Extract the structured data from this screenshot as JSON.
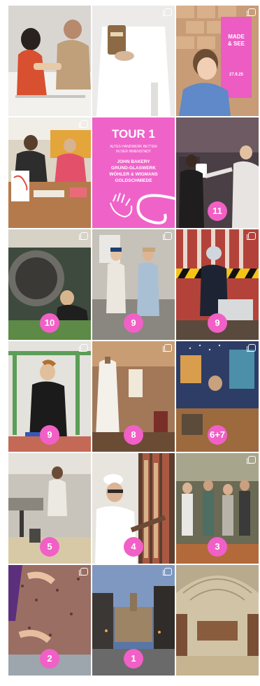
{
  "poster": {
    "title": "TOUR 1",
    "subtitle_line1": "ALTES HANDWERK BETTEN",
    "subtitle_line2": "IN DER INNENSTADT",
    "names": [
      "JOHN BAKERY",
      "GRUND-GLASWERK",
      "WÖHLER & WIGMANS",
      "GOLDSCHMIEDE"
    ]
  },
  "sign": {
    "line1": "MADE",
    "line2": "& SEE",
    "line3": "27.9.25"
  },
  "tiles": [
    {
      "name": "tile-workshop-kneading",
      "badge": ""
    },
    {
      "name": "tile-bread-bag",
      "badge": ""
    },
    {
      "name": "tile-woman-sign",
      "badge": ""
    },
    {
      "name": "tile-workshop-table",
      "badge": ""
    },
    {
      "name": "tile-tour-poster",
      "badge": ""
    },
    {
      "name": "tile-ticket-scan",
      "badge": "11"
    },
    {
      "name": "tile-copper-kettle",
      "badge": "10"
    },
    {
      "name": "tile-kitchen-visitors",
      "badge": "9"
    },
    {
      "name": "tile-boy-helmet",
      "badge": "9"
    },
    {
      "name": "tile-young-man-workbench",
      "badge": "9"
    },
    {
      "name": "tile-dress-form",
      "badge": "8"
    },
    {
      "name": "tile-blue-room",
      "badge": "6+7"
    },
    {
      "name": "tile-workshop-machines",
      "badge": "5"
    },
    {
      "name": "tile-hat-man-books",
      "badge": "4"
    },
    {
      "name": "tile-crowd-shop",
      "badge": "3"
    },
    {
      "name": "tile-granite-cutting",
      "badge": "2"
    },
    {
      "name": "tile-evening-street",
      "badge": "1"
    },
    {
      "name": "tile-vaulted-hall",
      "badge": ""
    }
  ],
  "colors": {
    "accent": "#ef63c9"
  }
}
